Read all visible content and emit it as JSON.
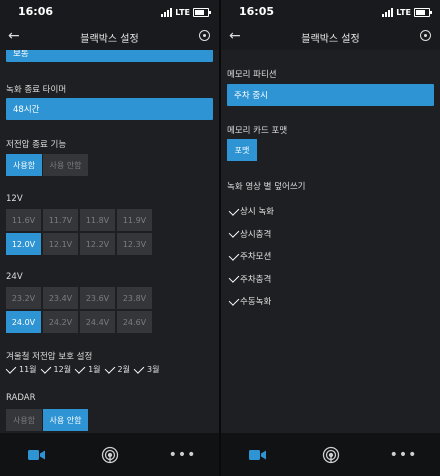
{
  "status": {
    "left_time": "16:06",
    "right_time": "16:05",
    "network": "LTE"
  },
  "header": {
    "title": "블랙박스 설정"
  },
  "left": {
    "top_partial_value": "보통",
    "rec_timer": {
      "label": "녹화 종료 타이머",
      "value": "48시간"
    },
    "low_voltage": {
      "label": "저전압 종료 기능",
      "options": [
        "사용함",
        "사용 안함"
      ],
      "selected": "사용함"
    },
    "v12": {
      "label": "12V",
      "options": [
        "11.6V",
        "11.7V",
        "11.8V",
        "11.9V",
        "12.0V",
        "12.1V",
        "12.2V",
        "12.3V"
      ],
      "selected": "12.0V"
    },
    "v24": {
      "label": "24V",
      "options": [
        "23.2V",
        "23.4V",
        "23.6V",
        "23.8V",
        "24.0V",
        "24.2V",
        "24.4V",
        "24.6V"
      ],
      "selected": "24.0V"
    },
    "winter": {
      "label": "겨울철 저전압 보호 설정",
      "months": [
        "11월",
        "12월",
        "1월",
        "2월",
        "3월"
      ]
    },
    "radar": {
      "label": "RADAR",
      "options": [
        "사용함",
        "사용 안함"
      ],
      "selected": "사용 안함"
    }
  },
  "right": {
    "partition": {
      "label": "메모리 파티션",
      "value": "주차 중시"
    },
    "format": {
      "label": "메모리 카드 포맷",
      "button": "포맷"
    },
    "overwrite": {
      "label": "녹화 영상 별 덮어쓰기",
      "items": [
        "상시 녹화",
        "상시충격",
        "주차모션",
        "주차충격",
        "수동녹화"
      ]
    }
  },
  "colors": {
    "accent": "#2e94d3",
    "background": "#1e1f22",
    "nav": "#111214"
  },
  "nav_icons": [
    "video-camera-icon",
    "broadcast-icon",
    "more-icon"
  ]
}
